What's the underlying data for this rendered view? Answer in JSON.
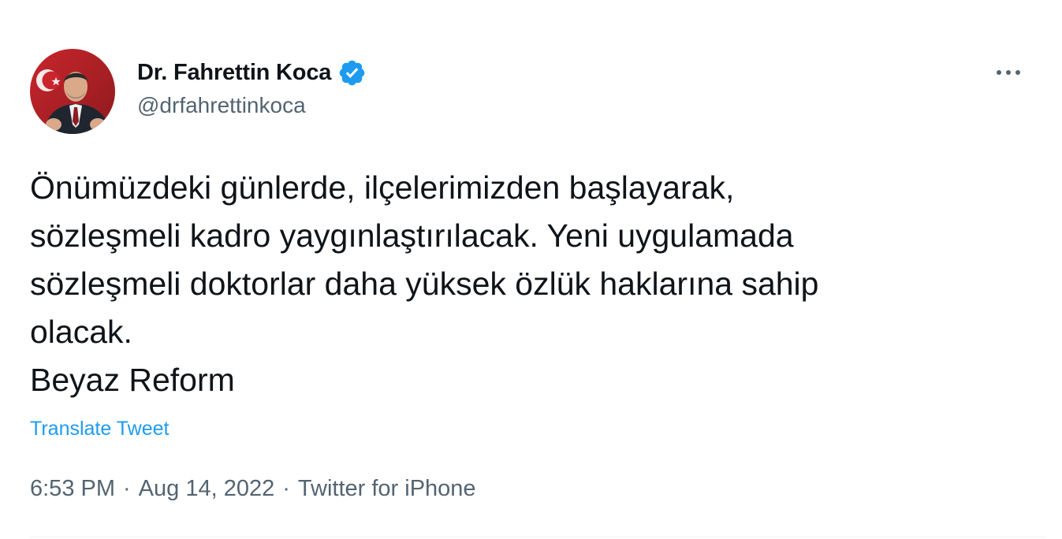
{
  "author": {
    "display_name": "Dr. Fahrettin Koca",
    "handle": "@drfahrettinkoca",
    "verified": true,
    "avatar_icon": "avatar-photo"
  },
  "menu_icon": "more-horizontal-icon",
  "tweet": {
    "text": "Önümüzdeki günlerde, ilçelerimizden başlayarak,\nsözleşmeli kadro yaygınlaştırılacak. Yeni uygulamada\nsözleşmeli doktorlar daha yüksek özlük haklarına sahip\nolacak.\nBeyaz Reform",
    "translate_label": "Translate Tweet"
  },
  "meta": {
    "time": "6:53 PM",
    "separator": "·",
    "date": "Aug 14, 2022",
    "source": "Twitter for iPhone"
  },
  "colors": {
    "text_primary": "#0f1419",
    "text_secondary": "#536471",
    "accent": "#1d9bf0"
  }
}
